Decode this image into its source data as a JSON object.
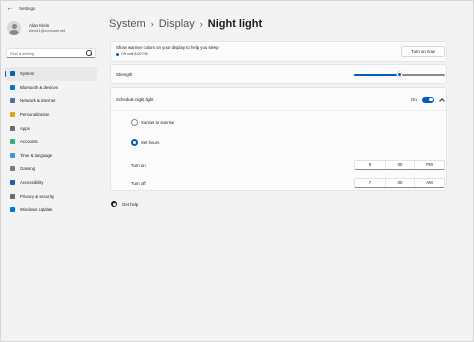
{
  "window": {
    "app_title": "Settings"
  },
  "profile": {
    "name": "Alan Klein",
    "email": "klein11@comcast.net"
  },
  "search": {
    "placeholder": "Find a setting"
  },
  "nav": {
    "items": [
      {
        "label": "System",
        "icon": "monitor-icon",
        "color": "#0067c0",
        "selected": true
      },
      {
        "label": "Bluetooth & devices",
        "icon": "bluetooth-icon",
        "color": "#0078d4"
      },
      {
        "label": "Network & internet",
        "icon": "wifi-icon",
        "color": "#4a6fa5"
      },
      {
        "label": "Personalization",
        "icon": "brush-icon",
        "color": "#e3a21a"
      },
      {
        "label": "Apps",
        "icon": "apps-icon",
        "color": "#6b6b6b"
      },
      {
        "label": "Accounts",
        "icon": "person-icon",
        "color": "#2bb673"
      },
      {
        "label": "Time & language",
        "icon": "globe-clock-icon",
        "color": "#3a96dd"
      },
      {
        "label": "Gaming",
        "icon": "gamepad-icon",
        "color": "#7a7a7a"
      },
      {
        "label": "Accessibility",
        "icon": "accessibility-icon",
        "color": "#1f5fa8"
      },
      {
        "label": "Privacy & security",
        "icon": "shield-icon",
        "color": "#6b6b6b"
      },
      {
        "label": "Windows Update",
        "icon": "refresh-icon",
        "color": "#0078d4"
      }
    ]
  },
  "breadcrumb": {
    "level1": "System",
    "level2": "Display",
    "current": "Night light",
    "separator": "›"
  },
  "night_light": {
    "description": "Show warmer colors on your display to help you sleep",
    "status": "Off until 8:00 PM",
    "status_color": "#0067c0",
    "turn_on_label": "Turn on now"
  },
  "strength": {
    "label": "Strength",
    "value_fraction": 0.5
  },
  "schedule": {
    "label": "Schedule night light",
    "toggle_text": "On",
    "toggle_state": "on",
    "option_sunset": "Sunset to sunrise",
    "option_hours": "Set hours",
    "selected_option": "Set hours",
    "turn_on": {
      "label": "Turn on",
      "hour": "9",
      "minute": "00",
      "period": "PM"
    },
    "turn_off": {
      "label": "Turn off",
      "hour": "7",
      "minute": "00",
      "period": "AM"
    }
  },
  "help": {
    "label": "Get help",
    "icon": "help-icon"
  },
  "colors": {
    "accent": "#005fb8",
    "background": "#f3f3f3",
    "card": "#fbfbfb"
  }
}
